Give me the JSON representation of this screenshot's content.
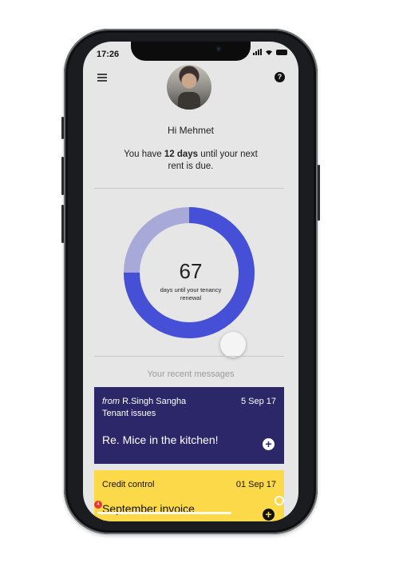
{
  "status": {
    "time": "17:26"
  },
  "header": {
    "help_glyph": "?"
  },
  "greeting": "Hi Mehmet",
  "rent": {
    "prefix": "You have ",
    "days": "12 days",
    "suffix": " until your next rent is due."
  },
  "tenancy": {
    "days": "67",
    "caption": "days until your tenancy renewal",
    "progress_fraction": 0.75
  },
  "recent_label": "Your recent messages",
  "messages": [
    {
      "from_prefix": "from ",
      "from": "R.Singh Sangha",
      "category": "Tenant issues",
      "date": "5 Sep 17",
      "subject": "Re. Mice in the kitchen!"
    },
    {
      "from": "Credit control",
      "date": "01 Sep 17",
      "subject": "September invoice"
    }
  ],
  "badge_count": "4",
  "colors": {
    "accent": "#4650d6",
    "track": "#a7a9d9",
    "card_dark": "#2c2768",
    "card_yellow": "#fbd948",
    "badge": "#e53935"
  },
  "icons": {
    "menu": "hamburger-icon",
    "help": "question-icon",
    "add": "plus-circle-icon"
  }
}
